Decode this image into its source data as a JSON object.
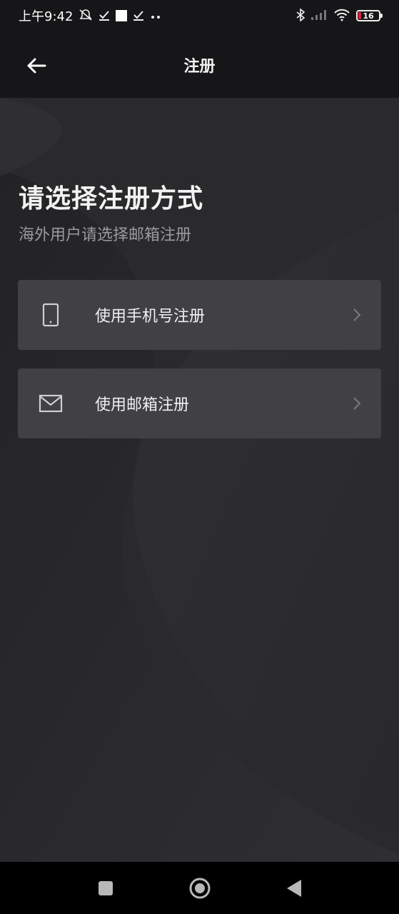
{
  "status_bar": {
    "time": "上午9:42",
    "battery_level": "16",
    "icons": [
      "mute-icon",
      "check-icon",
      "square-icon",
      "check-icon",
      "more-dots-icon",
      "bluetooth-icon",
      "signal-icon",
      "wifi-icon",
      "battery-icon"
    ]
  },
  "appbar": {
    "title": "注册",
    "back_icon": "arrow-left-icon"
  },
  "main": {
    "heading": "请选择注册方式",
    "subheading": "海外用户请选择邮箱注册",
    "options": [
      {
        "label": "使用手机号注册",
        "icon": "phone-icon"
      },
      {
        "label": "使用邮箱注册",
        "icon": "mail-icon"
      }
    ]
  },
  "nav_bar": {
    "buttons": [
      "recents-square-icon",
      "home-circle-icon",
      "back-triangle-icon"
    ]
  },
  "colors": {
    "background": "#2b2b2e",
    "header": "#161618",
    "card": "#404045",
    "subtext": "#9a9a9e"
  }
}
